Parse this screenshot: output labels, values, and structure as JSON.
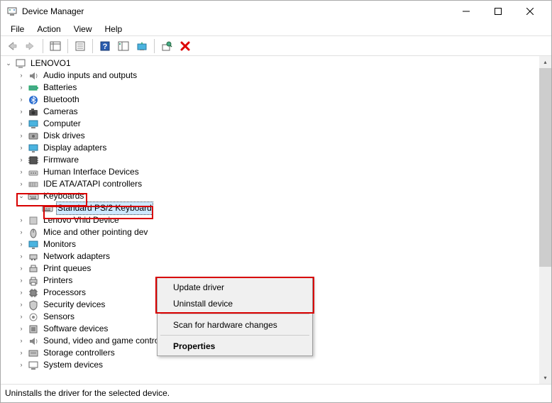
{
  "window": {
    "title": "Device Manager"
  },
  "menu": {
    "file": "File",
    "action": "Action",
    "view": "View",
    "help": "Help"
  },
  "tree": {
    "root": "LENOVO1",
    "items": [
      "Audio inputs and outputs",
      "Batteries",
      "Bluetooth",
      "Cameras",
      "Computer",
      "Disk drives",
      "Display adapters",
      "Firmware",
      "Human Interface Devices",
      "IDE ATA/ATAPI controllers",
      "Keyboards",
      "Lenovo Vhid Device",
      "Mice and other pointing dev",
      "Monitors",
      "Network adapters",
      "Print queues",
      "Printers",
      "Processors",
      "Security devices",
      "Sensors",
      "Software devices",
      "Sound, video and game controllers",
      "Storage controllers",
      "System devices"
    ],
    "keyboard_child": "Standard PS/2 Keyboard"
  },
  "context_menu": {
    "update": "Update driver",
    "uninstall": "Uninstall device",
    "scan": "Scan for hardware changes",
    "properties": "Properties"
  },
  "status": "Uninstalls the driver for the selected device."
}
